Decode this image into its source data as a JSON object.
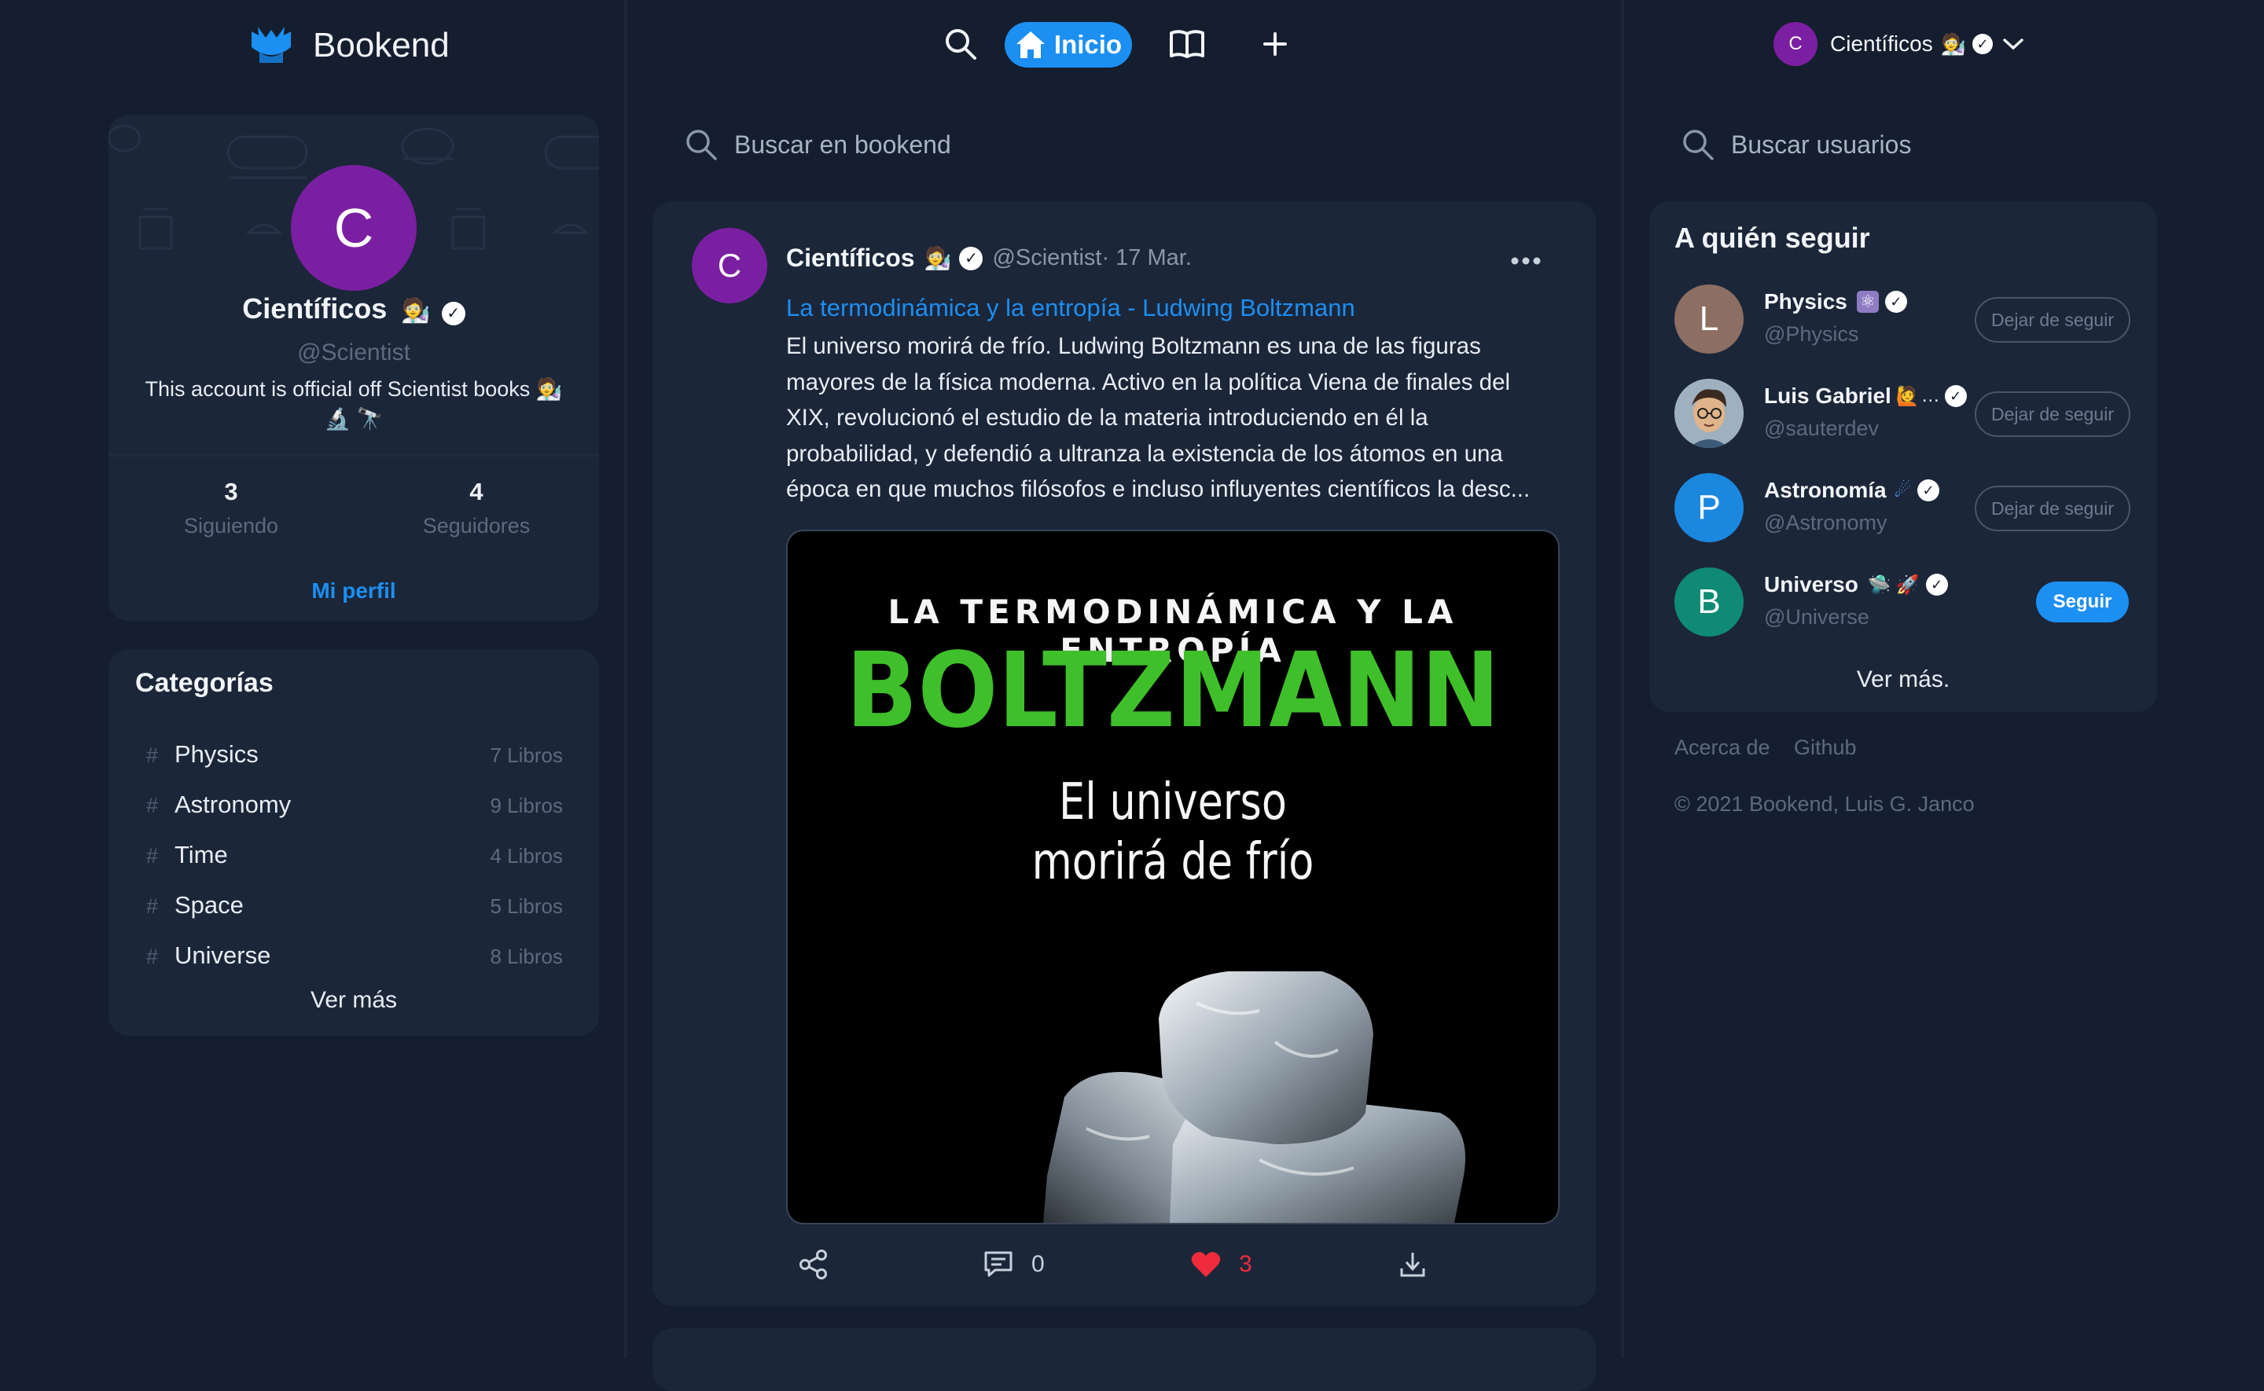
{
  "brand": {
    "name": "Bookend"
  },
  "topnav": {
    "home_label": "Inicio",
    "user_name": "Científicos",
    "user_initial": "C"
  },
  "search": {
    "feed_placeholder": "Buscar en bookend",
    "users_placeholder": "Buscar usuarios"
  },
  "profile": {
    "initial": "C",
    "name": "Científicos",
    "handle": "@Scientist",
    "bio": "This account is official off Scientist books",
    "following_count": "3",
    "following_label": "Siguiendo",
    "followers_count": "4",
    "followers_label": "Seguidores",
    "profile_link": "Mi perfil"
  },
  "categories": {
    "title": "Categorías",
    "items": [
      {
        "name": "Physics",
        "count": "7 Libros"
      },
      {
        "name": "Astronomy",
        "count": "9 Libros"
      },
      {
        "name": "Time",
        "count": "4 Libros"
      },
      {
        "name": "Space",
        "count": "5 Libros"
      },
      {
        "name": "Universe",
        "count": "8 Libros"
      }
    ],
    "more": "Ver más"
  },
  "post": {
    "author_initial": "C",
    "author": "Científicos",
    "handle": "@Scientist·",
    "date": "17 Mar.",
    "title_link": "La termodinámica y la entropía - Ludwing Boltzmann",
    "body": "El universo morirá de frío. Ludwing Boltzmann es una de las figuras mayores de la física moderna. Activo en la política Viena de finales del XIX, revolucionó el estudio de la materia introduciendo en él la probabilidad, y defendió a ultranza la existencia de los átomos en una época en que muchos filósofos e incluso influyentes científicos la desc...",
    "cover": {
      "top": "LA TERMODINÁMICA Y LA ENTROPÍA",
      "name": "BOLTZMANN",
      "line1": "El universo",
      "line2": "morirá de frío"
    },
    "comments": "0",
    "likes": "3"
  },
  "who_to_follow": {
    "title": "A quién seguir",
    "users": [
      {
        "initial": "L",
        "name": "Physics",
        "handle": "@Physics",
        "button": "Dejar de seguir",
        "color": "#8d6e63"
      },
      {
        "initial": "",
        "name": "Luis Gabriel",
        "handle": "@sauterdev",
        "button": "Dejar de seguir",
        "color": "#7b8a99"
      },
      {
        "initial": "P",
        "name": "Astronomía",
        "handle": "@Astronomy",
        "button": "Dejar de seguir",
        "color": "#1b88e0"
      },
      {
        "initial": "B",
        "name": "Universo",
        "handle": "@Universe",
        "button": "Seguir",
        "color": "#0f8a75"
      }
    ],
    "more": "Ver más."
  },
  "footer": {
    "about": "Acerca de",
    "github": "Github",
    "copyright": "© 2021 Bookend, Luis G. Janco"
  },
  "colors": {
    "background": "#151e2e",
    "card": "#1c2639",
    "accent": "#1c8ff2",
    "purple": "#7b1fa2",
    "like": "#ef2b3c"
  }
}
